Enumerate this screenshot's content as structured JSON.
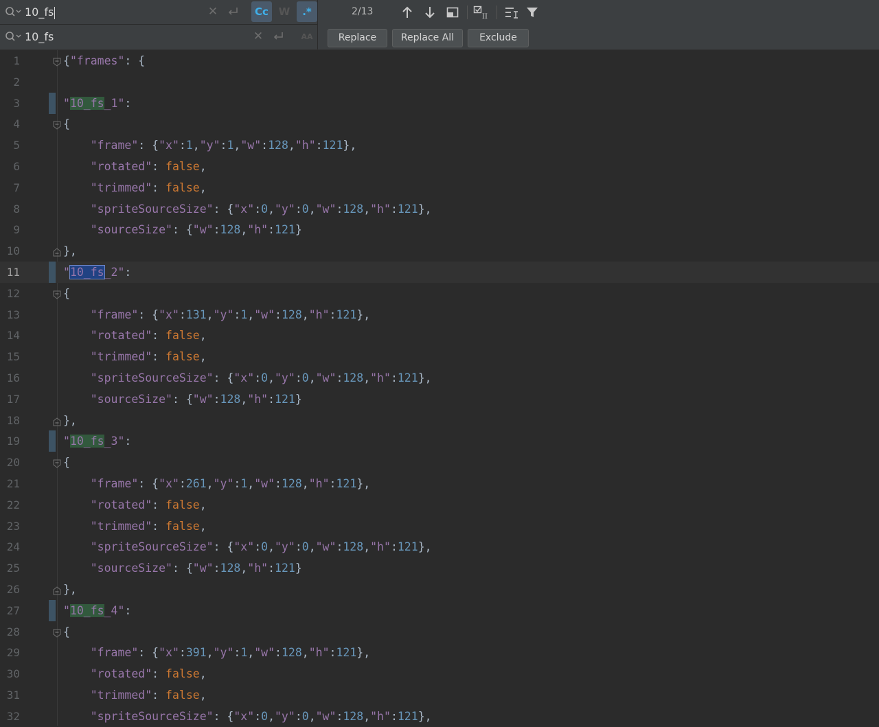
{
  "search": {
    "query": "10_fs",
    "match_count": "2/13",
    "match_case_label": "Cc",
    "words_label": "W",
    "regex_label": ".*"
  },
  "replace": {
    "value": "10_fs",
    "preserve_case_label": "AA",
    "replace_label": "Replace",
    "replace_all_label": "Replace All",
    "exclude_label": "Exclude"
  },
  "icons": {
    "search": "magnifier-icon",
    "clear": "close-icon",
    "newline": "newline-icon",
    "prev": "arrow-up-icon",
    "next": "arrow-down-icon",
    "select_all": "select-all-occurrences-icon",
    "in_selection": "in-selection-icon",
    "multiline": "multiline-icon",
    "filter": "filter-icon"
  },
  "colors": {
    "background": "#2b2b2b",
    "key": "#9876aa",
    "number": "#6897bb",
    "keyword": "#cc7832",
    "match_highlight": "#32593d",
    "current_match": "#214283"
  },
  "editor": {
    "current_line": 11,
    "lines": [
      {
        "n": "1",
        "t": "{\"frames\": {"
      },
      {
        "n": "2",
        "t": ""
      },
      {
        "n": "3",
        "t": "\"10_fs_1\":"
      },
      {
        "n": "4",
        "t": "{"
      },
      {
        "n": "5",
        "t": "    \"frame\": {\"x\":1,\"y\":1,\"w\":128,\"h\":121},"
      },
      {
        "n": "6",
        "t": "    \"rotated\": false,"
      },
      {
        "n": "7",
        "t": "    \"trimmed\": false,"
      },
      {
        "n": "8",
        "t": "    \"spriteSourceSize\": {\"x\":0,\"y\":0,\"w\":128,\"h\":121},"
      },
      {
        "n": "9",
        "t": "    \"sourceSize\": {\"w\":128,\"h\":121}"
      },
      {
        "n": "10",
        "t": "},"
      },
      {
        "n": "11",
        "t": "\"10_fs_2\":"
      },
      {
        "n": "12",
        "t": "{"
      },
      {
        "n": "13",
        "t": "    \"frame\": {\"x\":131,\"y\":1,\"w\":128,\"h\":121},"
      },
      {
        "n": "14",
        "t": "    \"rotated\": false,"
      },
      {
        "n": "15",
        "t": "    \"trimmed\": false,"
      },
      {
        "n": "16",
        "t": "    \"spriteSourceSize\": {\"x\":0,\"y\":0,\"w\":128,\"h\":121},"
      },
      {
        "n": "17",
        "t": "    \"sourceSize\": {\"w\":128,\"h\":121}"
      },
      {
        "n": "18",
        "t": "},"
      },
      {
        "n": "19",
        "t": "\"10_fs_3\":"
      },
      {
        "n": "20",
        "t": "{"
      },
      {
        "n": "21",
        "t": "    \"frame\": {\"x\":261,\"y\":1,\"w\":128,\"h\":121},"
      },
      {
        "n": "22",
        "t": "    \"rotated\": false,"
      },
      {
        "n": "23",
        "t": "    \"trimmed\": false,"
      },
      {
        "n": "24",
        "t": "    \"spriteSourceSize\": {\"x\":0,\"y\":0,\"w\":128,\"h\":121},"
      },
      {
        "n": "25",
        "t": "    \"sourceSize\": {\"w\":128,\"h\":121}"
      },
      {
        "n": "26",
        "t": "},"
      },
      {
        "n": "27",
        "t": "\"10_fs_4\":"
      },
      {
        "n": "28",
        "t": "{"
      },
      {
        "n": "29",
        "t": "    \"frame\": {\"x\":391,\"y\":1,\"w\":128,\"h\":121},"
      },
      {
        "n": "30",
        "t": "    \"rotated\": false,"
      },
      {
        "n": "31",
        "t": "    \"trimmed\": false,"
      },
      {
        "n": "32",
        "t": "    \"spriteSourceSize\": {\"x\":0,\"y\":0,\"w\":128,\"h\":121},"
      }
    ]
  }
}
